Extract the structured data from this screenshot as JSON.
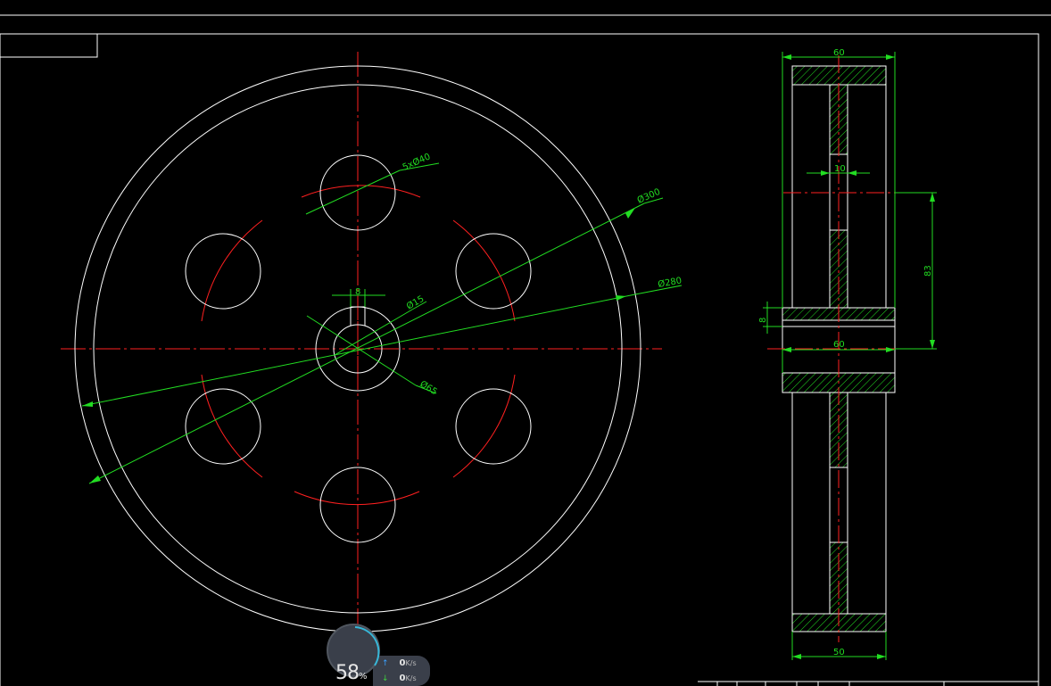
{
  "drawing": {
    "front_view": {
      "dim_holes": "5xØ40",
      "dim_outer": "Ø300",
      "dim_rim": "Ø280",
      "dim_bore": "Ø15",
      "dim_hub": "Ø65",
      "dim_key": "8"
    },
    "side_view": {
      "dim_top_width": "60",
      "dim_web": "10",
      "dim_height": "83",
      "dim_hub_width": "60",
      "dim_key_depth": "8",
      "dim_bottom_width": "50"
    },
    "colors": {
      "outline": "#ffffff",
      "centerline": "#ff2020",
      "dimension": "#22dd22",
      "hatch": "#22dd22"
    }
  },
  "system_monitor": {
    "percent": "58",
    "percent_unit": "%",
    "upload_value": "0",
    "upload_unit": "K/s",
    "download_value": "0",
    "download_unit": "K/s"
  }
}
